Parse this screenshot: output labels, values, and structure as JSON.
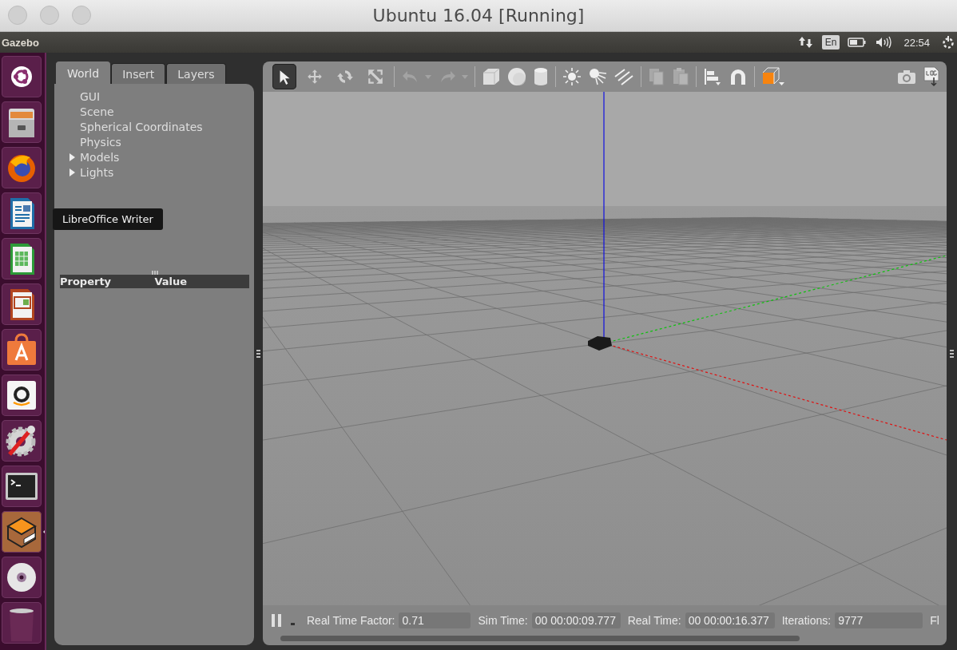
{
  "window": {
    "title": "Ubuntu 16.04 [Running]"
  },
  "top_panel": {
    "app_name": "Gazebo",
    "keyboard": "En",
    "clock": "22:54"
  },
  "launcher": {
    "items": [
      {
        "kind": "ubuntu",
        "running": false
      },
      {
        "kind": "files",
        "running": false
      },
      {
        "kind": "firefox",
        "running": false
      },
      {
        "kind": "writer",
        "running": false
      },
      {
        "kind": "calc",
        "running": false
      },
      {
        "kind": "impress",
        "running": false
      },
      {
        "kind": "store",
        "running": false
      },
      {
        "kind": "amazon",
        "running": false
      },
      {
        "kind": "settings",
        "running": false
      },
      {
        "kind": "terminal",
        "running": false
      },
      {
        "kind": "gazebo",
        "running": true
      },
      {
        "kind": "disc",
        "running": false
      },
      {
        "kind": "trash",
        "running": false
      }
    ],
    "tooltip": "LibreOffice Writer"
  },
  "tabs": [
    {
      "label": "World",
      "selected": true
    },
    {
      "label": "Insert",
      "selected": false
    },
    {
      "label": "Layers",
      "selected": false
    }
  ],
  "tree": [
    {
      "label": "GUI",
      "kind": "leaf"
    },
    {
      "label": "Scene",
      "kind": "leaf"
    },
    {
      "label": "Spherical Coordinates",
      "kind": "leaf"
    },
    {
      "label": "Physics",
      "kind": "leaf"
    },
    {
      "label": "Models",
      "kind": "group"
    },
    {
      "label": "Lights",
      "kind": "group"
    }
  ],
  "property_table": {
    "columns": [
      "Property",
      "Value"
    ]
  },
  "toolbar": {
    "tools": [
      {
        "kind": "select",
        "selected": true
      },
      {
        "kind": "translate",
        "selected": false
      },
      {
        "kind": "rotate",
        "selected": false
      },
      {
        "kind": "scale",
        "selected": false
      }
    ]
  },
  "status_bar": {
    "stats": [
      {
        "label": "Real Time Factor:",
        "value": "0.71"
      },
      {
        "label": "Sim Time:",
        "value": "00 00:00:09.777"
      },
      {
        "label": "Real Time:",
        "value": "00 00:00:16.377"
      },
      {
        "label": "Iterations:",
        "value": "9777"
      }
    ],
    "cut_label": "Fl"
  }
}
